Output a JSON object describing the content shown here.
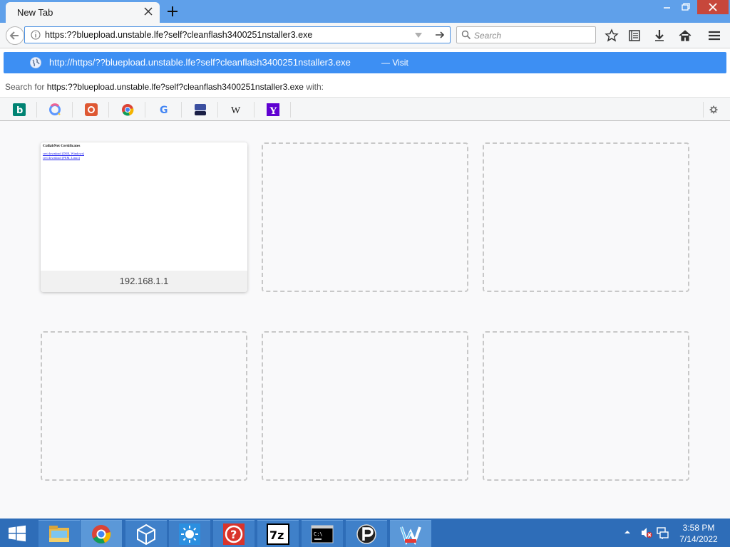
{
  "window": {
    "tab_title": "New Tab"
  },
  "navbar": {
    "url": "https:??blueplоad.unstable.lfe?self?cleanflash3400251nstaller3.exe",
    "search_placeholder": "Search"
  },
  "autocomplete": {
    "suggestion_url": "http://https/??blueplоad.unstable.lfe?self?cleanflash3400251nstaller3.exe",
    "visit_label": "— Visit",
    "search_for_prefix": "Search for",
    "search_for_query": "https:??blueplоad.unstable.lfe?self?cleanflash3400251nstaller3.exe",
    "search_for_suffix": "with:"
  },
  "search_engines": [
    {
      "icon": "bing-icon",
      "letter": "b",
      "color": "#008373"
    },
    {
      "icon": "qwant-icon",
      "letter": "",
      "color": "#5c97ff"
    },
    {
      "icon": "duckduckgo-icon",
      "letter": "",
      "color": "#de5833"
    },
    {
      "icon": "chrome-search-icon",
      "letter": "",
      "color": "#4caf50"
    },
    {
      "icon": "google-icon",
      "letter": "G",
      "color": "#4285f4"
    },
    {
      "icon": "stack-icon",
      "letter": "",
      "color": "#3b4fa0"
    },
    {
      "icon": "wikipedia-icon",
      "letter": "W",
      "color": "#222222"
    },
    {
      "icon": "yahoo-icon",
      "letter": "Y",
      "color": "#5f01d1"
    }
  ],
  "tiles": [
    {
      "caption": "192.168.1.1",
      "thumb_title": "CollabNet Certificates",
      "thumb_links": [
        "cert download (DER, Windows)",
        "cert download (PEM, Linux)"
      ]
    }
  ],
  "taskbar": {
    "apps": [
      "file-explorer-icon",
      "chrome-icon",
      "unity-icon",
      "weather-icon",
      "help-icon",
      "7zip-icon",
      "cmd-icon",
      "proxy-icon",
      "wgestures-icon"
    ],
    "time": "3:58 PM",
    "date": "7/14/2022"
  },
  "colors": {
    "titlebar": "#5fa0ea",
    "highlight": "#3d8ff3",
    "taskbar": "#2e6db8",
    "close": "#c7473b"
  }
}
